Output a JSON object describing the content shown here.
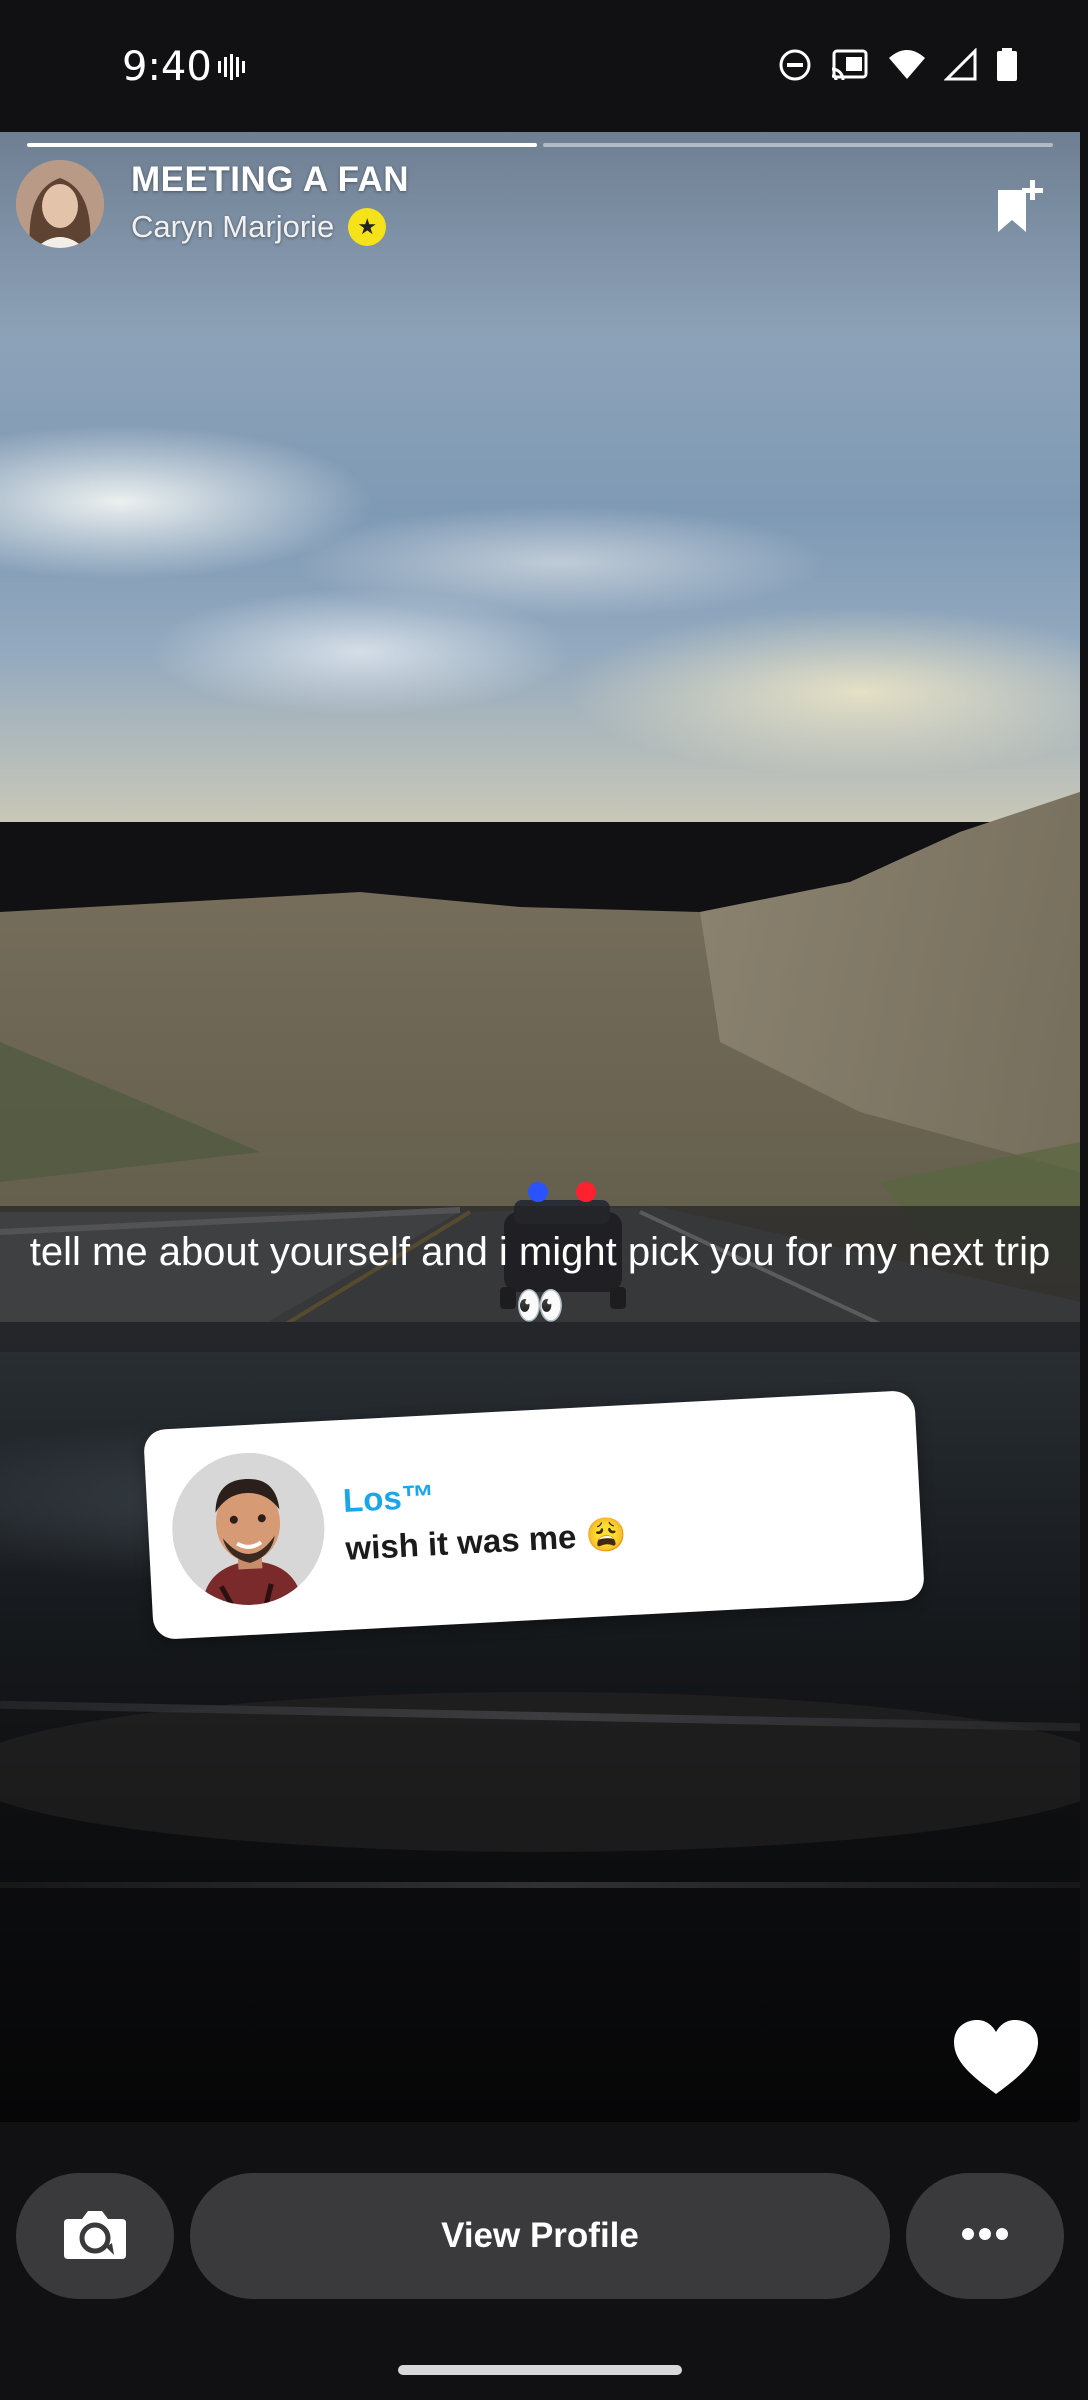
{
  "status_bar": {
    "time": "9:40",
    "icons": [
      "vibrate-icon",
      "do-not-disturb-icon",
      "cast-icon",
      "wifi-icon",
      "signal-icon",
      "battery-icon"
    ]
  },
  "story": {
    "title": "MEETING A FAN",
    "creator": "Caryn Marjorie",
    "creator_badge": "star-badge-icon",
    "caption": "tell me about yourself and i might pick you for my next trip 👀",
    "progress_segments_total": 2,
    "progress_segments_done": 1,
    "reply_sticker": {
      "name": "Los™",
      "message": "wish it was me 😩"
    }
  },
  "actions": {
    "view_profile_label": "View Profile"
  },
  "colors": {
    "background": "#111113",
    "button": "#3a3a3c",
    "sticker_name": "#1aa6e8",
    "badge": "#f5e21a"
  }
}
